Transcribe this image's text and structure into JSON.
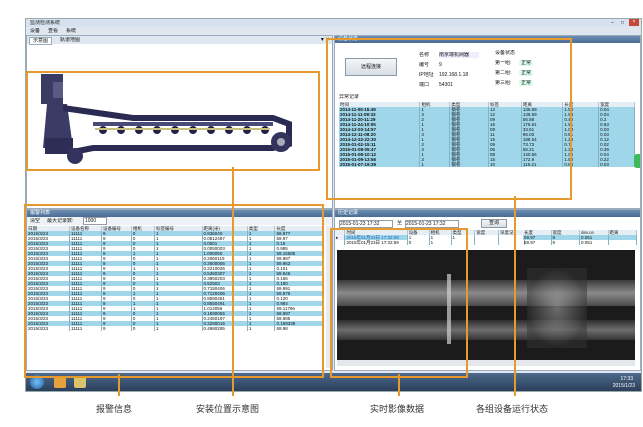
{
  "window": {
    "title": "监测检测系统"
  },
  "menu": [
    "设备",
    "查看",
    "系统"
  ],
  "tabs": [
    "示意图",
    "轨道地图"
  ],
  "alarm": {
    "title": "报警列表",
    "clear_label": "清空",
    "max_label": "最大记录数:",
    "max_value": "1000",
    "headers": [
      "日期",
      "设备名称",
      "设备编号",
      "相机",
      "标签编号",
      "距离(米)",
      "类型",
      "长度"
    ],
    "rows": [
      [
        "2015/3/23",
        "11111",
        "9",
        "0",
        "1",
        "0.836040",
        "1",
        "59.977"
      ],
      [
        "2015/3/23",
        "11111",
        "9",
        "0",
        "1",
        "0.0512487",
        "1",
        "59.97"
      ],
      [
        "2015/3/23",
        "11111",
        "9",
        "0",
        "1",
        "0.0501",
        "1",
        "0.16"
      ],
      [
        "2015/3/23",
        "11111",
        "9",
        "0",
        "1",
        "0.0050003",
        "1",
        "0.985"
      ],
      [
        "2015/3/23",
        "11111",
        "9",
        "1",
        "1",
        "1.006050",
        "1",
        "59.16585"
      ],
      [
        "2015/3/23",
        "11111",
        "9",
        "0",
        "1",
        "0.2060119",
        "1",
        "59.987"
      ],
      [
        "2015/3/23",
        "11111",
        "9",
        "0",
        "1",
        "0.3600056",
        "1",
        "59.963"
      ],
      [
        "2015/3/23",
        "11111",
        "9",
        "1",
        "1",
        "0.2210026",
        "1",
        "0.101"
      ],
      [
        "2015/3/23",
        "11111",
        "9",
        "0",
        "1",
        "0.5360307",
        "1",
        "59.945"
      ],
      [
        "2015/3/23",
        "11111",
        "9",
        "0",
        "1",
        "0.3950203",
        "1",
        "0.166"
      ],
      [
        "2015/3/23",
        "11111",
        "9",
        "0",
        "1",
        "0.52503",
        "1",
        "0.180"
      ],
      [
        "2015/3/23",
        "11111",
        "9",
        "0",
        "1",
        "0.7150406",
        "1",
        "59.991"
      ],
      [
        "2015/3/23",
        "11111",
        "9",
        "1",
        "1",
        "0.7120406",
        "1",
        "59.976"
      ],
      [
        "2015/3/23",
        "11111",
        "9",
        "0",
        "1",
        "0.8590461",
        "1",
        "0.120"
      ],
      [
        "2015/3/23",
        "11111",
        "9",
        "1",
        "1",
        "0.8550491",
        "1",
        "0.984"
      ],
      [
        "2015/3/23",
        "11111",
        "9",
        "1",
        "1",
        "1.014056",
        "1",
        "59.11796"
      ],
      [
        "2015/3/23",
        "11111",
        "9",
        "0",
        "1",
        "0.1590055",
        "1",
        "59.997"
      ],
      [
        "2015/3/23",
        "11111",
        "9",
        "0",
        "1",
        "0.2450197",
        "1",
        "59.985"
      ],
      [
        "2015/3/23",
        "11111",
        "9",
        "0",
        "1",
        "0.3280015",
        "1",
        "0.159339"
      ],
      [
        "2015/3/23",
        "11111",
        "9",
        "0",
        "1",
        "0.4980285",
        "1",
        "59.98"
      ]
    ]
  },
  "device_status": {
    "title": "设备状态",
    "connect_button": "远程连接",
    "name_label": "名称",
    "name_value": "南京端机网器",
    "id_label": "编号",
    "id_value": "9",
    "ip_label": "IP地址",
    "ip_value": "192.168.1.18",
    "port_label": "端口",
    "port_value": "54301",
    "state_title": "设备状态",
    "groups": [
      {
        "label": "第一组:",
        "value": "正常"
      },
      {
        "label": "第二组:",
        "value": "正常"
      },
      {
        "label": "第三组:",
        "value": "正常"
      }
    ],
    "records_title": "异常记录",
    "headers": [
      "时间",
      "相机",
      "类型",
      "标签",
      "距离",
      "长度",
      "宽度"
    ],
    "rows": [
      [
        "2014-11-05-15:49",
        "1",
        "钢卷",
        "12",
        "136.59",
        "1.53",
        "0.04"
      ],
      [
        "2014-11-11-09:33",
        "3",
        "钢卷",
        "12",
        "136.59",
        "1.53",
        "0.04"
      ],
      [
        "2014-11-20-11:29",
        "2",
        "钢卷",
        "09",
        "56.88",
        "0.43",
        "0.2"
      ],
      [
        "2014-11-24-10:05",
        "1",
        "钢卷",
        "16",
        "176.61",
        "1.91",
        "0.63"
      ],
      [
        "2014-12-03-14:57",
        "1",
        "钢卷",
        "08",
        "33.51",
        "1.03",
        "0.03"
      ],
      [
        "2014-12-11-08:20",
        "3",
        "钢卷",
        "11",
        "96.03",
        "0.81",
        "0.03"
      ],
      [
        "2014-12-22-22:30",
        "1",
        "钢卷",
        "15",
        "188.54",
        "1.24",
        "0.12"
      ],
      [
        "2015-01-02-15:11",
        "2",
        "钢卷",
        "09",
        "73.73",
        "0.7",
        "0.02"
      ],
      [
        "2015-01-08-05:47",
        "3",
        "钢卷",
        "05",
        "55.21",
        "1.33",
        "0.39"
      ],
      [
        "2015-01-08-10:12",
        "1",
        "钢卷",
        "08",
        "140.66",
        "1.05",
        "0.04"
      ],
      [
        "2015-01-09-13:56",
        "3",
        "钢卷",
        "15",
        "172.9",
        "1.53",
        "0.22"
      ],
      [
        "2015-01-07-19:29",
        "1",
        "钢卷",
        "10",
        "119.21",
        "0.59",
        "0.03"
      ]
    ]
  },
  "history": {
    "title": "历史记录",
    "from": "2015-01-23 17:32",
    "to_label": "至",
    "to": "2015-01-23 17:32",
    "query_button": "查询",
    "headers": [
      "时间",
      "设备",
      "相机",
      "类型",
      "宽度",
      "深度记"
    ],
    "right_headers": [
      "长度",
      "宽度",
      "dev.ce",
      "距离"
    ],
    "rows": [
      [
        "2015年01月23日 17:32:59",
        "1",
        "1",
        "1"
      ],
      [
        "2015年01月23日 17:32:59",
        "0",
        "1",
        ""
      ]
    ],
    "right_rows": [
      [
        "59.97",
        "9",
        "0.051"
      ],
      [
        "59.97",
        "9",
        "0.051"
      ]
    ]
  },
  "taskbar": {
    "time": "17:33",
    "date": "2015/1/23"
  },
  "callouts": [
    "报警信息",
    "安装位置示意图",
    "实时影像数据",
    "各组设备运行状态"
  ]
}
